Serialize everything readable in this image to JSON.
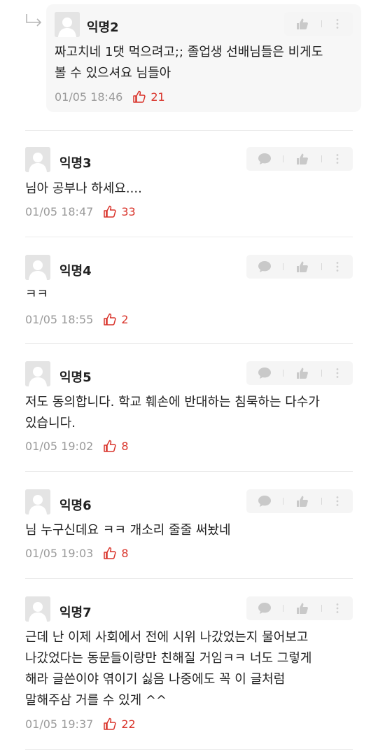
{
  "accent_color": "#d9342b",
  "icons": {
    "reply": "reply-arrow-icon",
    "comment": "speech-bubble-icon",
    "like": "thumbs-up-icon",
    "more": "vertical-dots-icon",
    "vote": "thumb-outline-icon"
  },
  "comments": [
    {
      "author": "익명2",
      "text": "짜고치네 1댓 먹으려고;; 졸업생 선배님들은 비게도\n볼 수 있으셔요 님들아",
      "time": "01/05 18:46",
      "likes": "21",
      "is_reply": true
    },
    {
      "author": "익명3",
      "text": "님아 공부나 하세요....",
      "time": "01/05 18:47",
      "likes": "33"
    },
    {
      "author": "익명4",
      "text": "ㅋㅋ",
      "time": "01/05 18:55",
      "likes": "2"
    },
    {
      "author": "익명5",
      "text": "저도 동의합니다. 학교 훼손에 반대하는 침묵하는 다수가\n있습니다.",
      "time": "01/05 19:02",
      "likes": "8"
    },
    {
      "author": "익명6",
      "text": "님 누구신데요 ㅋㅋ 개소리 줄줄 써놨네",
      "time": "01/05 19:03",
      "likes": "8"
    },
    {
      "author": "익명7",
      "text": "근데 난 이제 사회에서 전에 시위 나갔었는지 물어보고\n나갔었다는 동문들이랑만 친해질 거임ㅋㅋ 너도 그렇게\n해라 글쓴이야 엮이기 싫음 나중에도 꼭 이 글처럼\n말해주삼 거를 수 있게 ^^",
      "time": "01/05 19:37",
      "likes": "22"
    }
  ]
}
